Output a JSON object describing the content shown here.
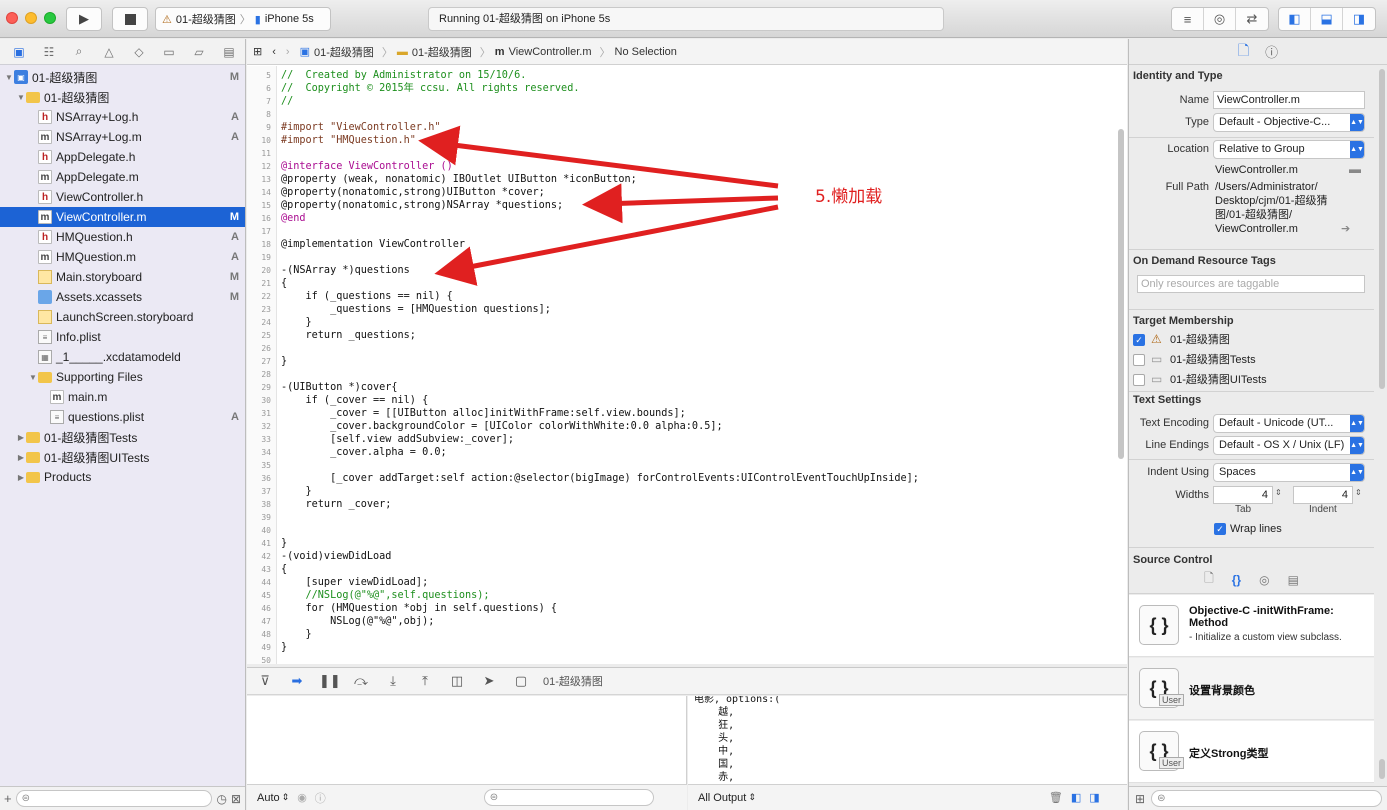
{
  "toolbar": {
    "scheme_project": "01-超级猜图",
    "scheme_device": "iPhone 5s",
    "activity_status": "Running 01-超级猜图 on iPhone 5s"
  },
  "navigator": {
    "items": [
      {
        "label": "01-超级猜图",
        "status": "M",
        "icon": "project-icon",
        "indent": 0,
        "expanded": true
      },
      {
        "label": "01-超级猜图",
        "status": "",
        "icon": "folder-icon",
        "indent": 1,
        "expanded": true
      },
      {
        "label": "NSArray+Log.h",
        "status": "A",
        "icon": "header-file-icon",
        "indent": 2
      },
      {
        "label": "NSArray+Log.m",
        "status": "A",
        "icon": "implementation-file-icon",
        "indent": 2
      },
      {
        "label": "AppDelegate.h",
        "status": "",
        "icon": "header-file-icon",
        "indent": 2
      },
      {
        "label": "AppDelegate.m",
        "status": "",
        "icon": "implementation-file-icon",
        "indent": 2
      },
      {
        "label": "ViewController.h",
        "status": "",
        "icon": "header-file-icon",
        "indent": 2
      },
      {
        "label": "ViewController.m",
        "status": "M",
        "icon": "implementation-file-icon",
        "indent": 2,
        "selected": true
      },
      {
        "label": "HMQuestion.h",
        "status": "A",
        "icon": "header-file-icon",
        "indent": 2
      },
      {
        "label": "HMQuestion.m",
        "status": "A",
        "icon": "implementation-file-icon",
        "indent": 2
      },
      {
        "label": "Main.storyboard",
        "status": "M",
        "icon": "storyboard-icon",
        "indent": 2
      },
      {
        "label": "Assets.xcassets",
        "status": "M",
        "icon": "assets-icon",
        "indent": 2
      },
      {
        "label": "LaunchScreen.storyboard",
        "status": "",
        "icon": "storyboard-icon",
        "indent": 2
      },
      {
        "label": "Info.plist",
        "status": "",
        "icon": "plist-icon",
        "indent": 2
      },
      {
        "label": "_1_____.xcdatamodeld",
        "status": "",
        "icon": "datamodel-icon",
        "indent": 2
      },
      {
        "label": "Supporting Files",
        "status": "",
        "icon": "folder-icon",
        "indent": 2,
        "expanded": true
      },
      {
        "label": "main.m",
        "status": "",
        "icon": "implementation-file-icon",
        "indent": 3
      },
      {
        "label": "questions.plist",
        "status": "A",
        "icon": "plist-icon",
        "indent": 3
      },
      {
        "label": "01-超级猜图Tests",
        "status": "",
        "icon": "folder-icon",
        "indent": 1,
        "expanded": false
      },
      {
        "label": "01-超级猜图UITests",
        "status": "",
        "icon": "folder-icon",
        "indent": 1,
        "expanded": false
      },
      {
        "label": "Products",
        "status": "",
        "icon": "folder-icon",
        "indent": 1,
        "expanded": false
      }
    ]
  },
  "jumpbar": {
    "project": "01-超级猜图",
    "group": "01-超级猜图",
    "file": "ViewController.m",
    "selection": "No Selection"
  },
  "editor": {
    "lines": [
      {
        "n": "5",
        "text": "//  Created by Administrator on 15/10/6.",
        "cls": "c-comment"
      },
      {
        "n": "6",
        "text": "//  Copyright © 2015年 ccsu. All rights reserved.",
        "cls": "c-comment"
      },
      {
        "n": "7",
        "text": "//",
        "cls": "c-comment"
      },
      {
        "n": "8",
        "text": "",
        "cls": ""
      },
      {
        "n": "9",
        "text": "#import \"ViewController.h\"",
        "cls": "c-dir"
      },
      {
        "n": "10",
        "text": "#import \"HMQuestion.h\"",
        "cls": "c-dir"
      },
      {
        "n": "11",
        "text": "",
        "cls": ""
      },
      {
        "n": "12",
        "text": "@interface ViewController ()",
        "cls": "c-kw"
      },
      {
        "n": "13",
        "text": "@property (weak, nonatomic) IBOutlet UIButton *iconButton;",
        "cls": ""
      },
      {
        "n": "14",
        "text": "@property(nonatomic,strong)UIButton *cover;",
        "cls": ""
      },
      {
        "n": "15",
        "text": "@property(nonatomic,strong)NSArray *questions;",
        "cls": ""
      },
      {
        "n": "16",
        "text": "@end",
        "cls": "c-kw"
      },
      {
        "n": "17",
        "text": "",
        "cls": ""
      },
      {
        "n": "18",
        "text": "@implementation ViewController",
        "cls": ""
      },
      {
        "n": "19",
        "text": "",
        "cls": ""
      },
      {
        "n": "20",
        "text": "-(NSArray *)questions",
        "cls": ""
      },
      {
        "n": "21",
        "text": "{",
        "cls": ""
      },
      {
        "n": "22",
        "text": "    if (_questions == nil) {",
        "cls": ""
      },
      {
        "n": "23",
        "text": "        _questions = [HMQuestion questions];",
        "cls": ""
      },
      {
        "n": "24",
        "text": "    }",
        "cls": ""
      },
      {
        "n": "25",
        "text": "    return _questions;",
        "cls": ""
      },
      {
        "n": "26",
        "text": "",
        "cls": ""
      },
      {
        "n": "27",
        "text": "}",
        "cls": ""
      },
      {
        "n": "28",
        "text": "",
        "cls": ""
      },
      {
        "n": "29",
        "text": "-(UIButton *)cover{",
        "cls": ""
      },
      {
        "n": "30",
        "text": "    if (_cover == nil) {",
        "cls": ""
      },
      {
        "n": "31",
        "text": "        _cover = [[UIButton alloc]initWithFrame:self.view.bounds];",
        "cls": ""
      },
      {
        "n": "32",
        "text": "        _cover.backgroundColor = [UIColor colorWithWhite:0.0 alpha:0.5];",
        "cls": ""
      },
      {
        "n": "33",
        "text": "        [self.view addSubview:_cover];",
        "cls": ""
      },
      {
        "n": "34",
        "text": "        _cover.alpha = 0.0;",
        "cls": ""
      },
      {
        "n": "35",
        "text": "",
        "cls": ""
      },
      {
        "n": "36",
        "text": "        [_cover addTarget:self action:@selector(bigImage) forControlEvents:UIControlEventTouchUpInside];",
        "cls": ""
      },
      {
        "n": "37",
        "text": "    }",
        "cls": ""
      },
      {
        "n": "38",
        "text": "    return _cover;",
        "cls": ""
      },
      {
        "n": "39",
        "text": "",
        "cls": ""
      },
      {
        "n": "40",
        "text": "",
        "cls": ""
      },
      {
        "n": "41",
        "text": "}",
        "cls": ""
      },
      {
        "n": "42",
        "text": "-(void)viewDidLoad",
        "cls": ""
      },
      {
        "n": "43",
        "text": "{",
        "cls": ""
      },
      {
        "n": "44",
        "text": "    [super viewDidLoad];",
        "cls": ""
      },
      {
        "n": "45",
        "text": "    //NSLog(@\"%@\",self.questions);",
        "cls": "c-comment"
      },
      {
        "n": "46",
        "text": "    for (HMQuestion *obj in self.questions) {",
        "cls": ""
      },
      {
        "n": "47",
        "text": "        NSLog(@\"%@\",obj);",
        "cls": ""
      },
      {
        "n": "48",
        "text": "    }",
        "cls": ""
      },
      {
        "n": "49",
        "text": "}",
        "cls": ""
      },
      {
        "n": "50",
        "text": "",
        "cls": ""
      }
    ]
  },
  "annotation": {
    "text": "5.懒加载",
    "color": "#e02020"
  },
  "debug": {
    "target": "01-超级猜图",
    "console_lines": [
      "电影, options:(",
      "    越,",
      "    狂,",
      "    头,",
      "    中,",
      "    国,",
      "    赤,"
    ],
    "auto_label": "Auto",
    "output_label": "All Output"
  },
  "inspector": {
    "identity_title": "Identity and Type",
    "name_label": "Name",
    "name_value": "ViewController.m",
    "type_label": "Type",
    "type_value": "Default - Objective-C...",
    "location_label": "Location",
    "location_value": "Relative to Group",
    "location_file": "ViewController.m",
    "fullpath_label": "Full Path",
    "fullpath_lines": [
      "/Users/Administrator/",
      "Desktop/cjm/01-超级猜",
      "图/01-超级猜图/",
      "ViewController.m"
    ],
    "odr_title": "On Demand Resource Tags",
    "odr_placeholder": "Only resources are taggable",
    "target_title": "Target Membership",
    "targets": [
      {
        "label": "01-超级猜图",
        "checked": true
      },
      {
        "label": "01-超级猜图Tests",
        "checked": false
      },
      {
        "label": "01-超级猜图UITests",
        "checked": false
      }
    ],
    "text_title": "Text Settings",
    "encoding_label": "Text Encoding",
    "encoding_value": "Default - Unicode (UT...",
    "endings_label": "Line Endings",
    "endings_value": "Default - OS X / Unix (LF)",
    "indent_label": "Indent Using",
    "indent_value": "Spaces",
    "widths_label": "Widths",
    "tab_value": "4",
    "indent_width_value": "4",
    "tab_caption": "Tab",
    "indent_caption": "Indent",
    "wrap_label": "Wrap lines",
    "source_title": "Source Control"
  },
  "library": {
    "items": [
      {
        "title": "Objective-C -initWithFrame: Method",
        "desc": "- Initialize a custom view subclass.",
        "badge": ""
      },
      {
        "title": "设置背景颜色",
        "desc": "",
        "badge": "User"
      },
      {
        "title": "定义Strong类型",
        "desc": "",
        "badge": "User"
      }
    ]
  }
}
